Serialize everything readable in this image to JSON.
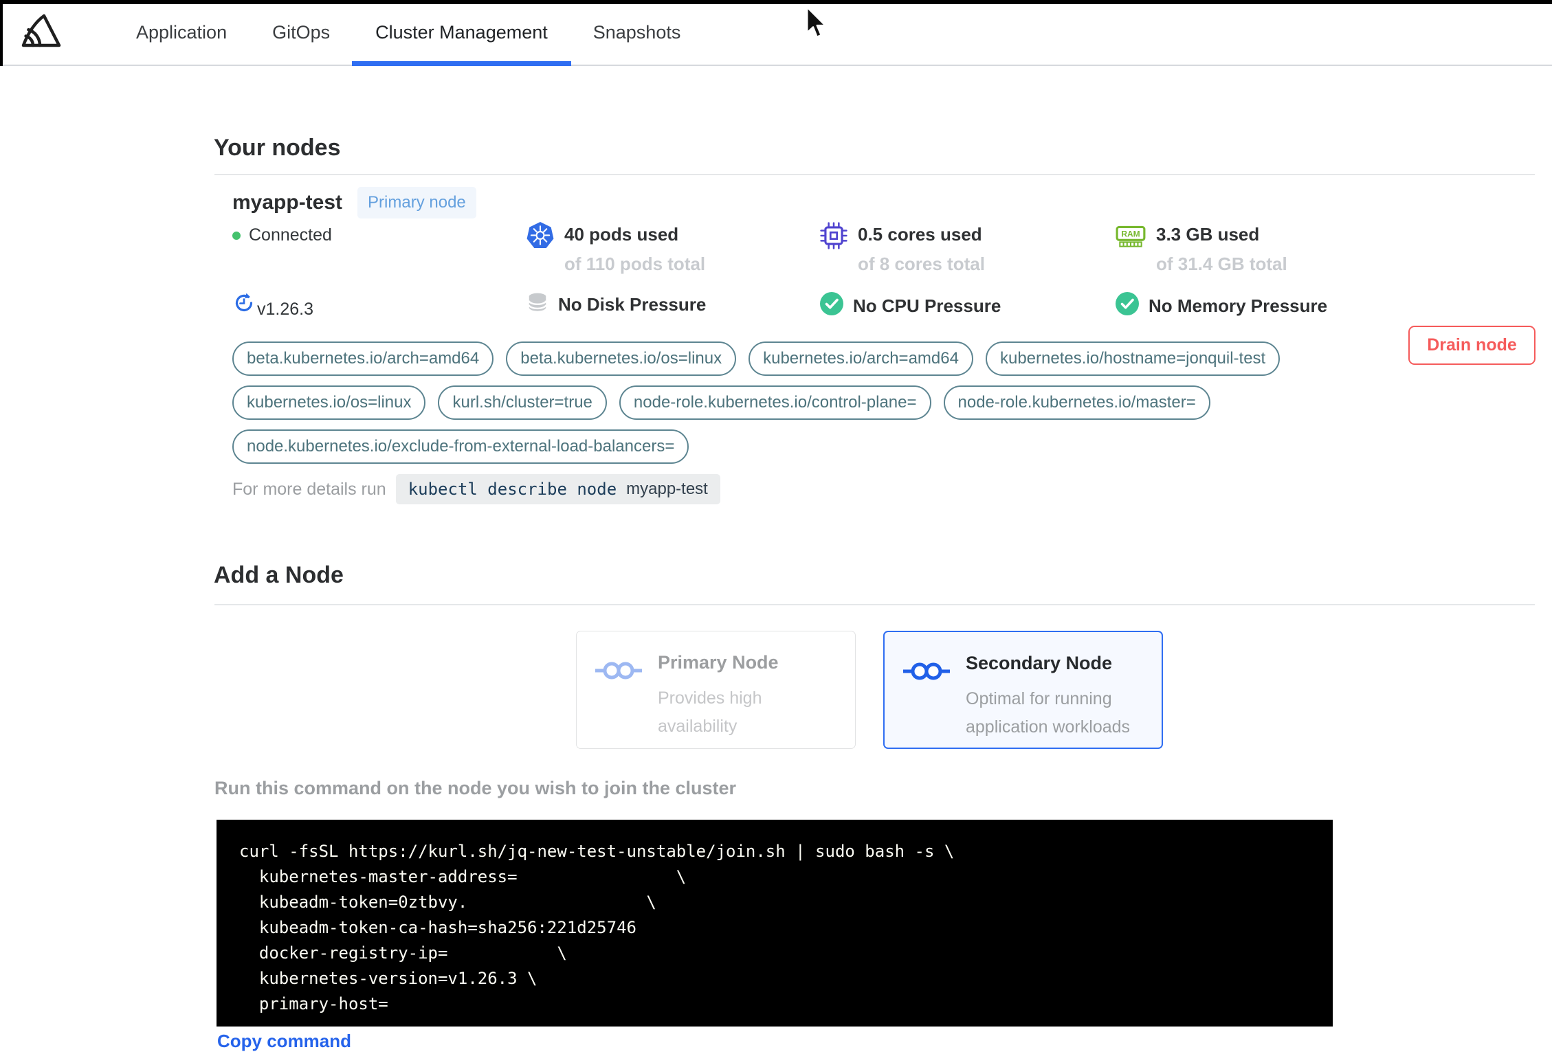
{
  "nav": {
    "tabs": [
      {
        "label": "Application"
      },
      {
        "label": "GitOps"
      },
      {
        "label": "Cluster Management"
      },
      {
        "label": "Snapshots"
      }
    ],
    "active_tab": "Cluster Management"
  },
  "your_nodes": {
    "heading": "Your nodes",
    "node": {
      "name": "myapp-test",
      "role_badge": "Primary node",
      "status": "Connected",
      "version": "v1.26.3",
      "pods": {
        "used": "40 pods used",
        "total": "of 110 pods total"
      },
      "cpu": {
        "used": "0.5 cores used",
        "total": "of 8 cores total"
      },
      "memory": {
        "used": "3.3 GB used",
        "total": "of 31.4 GB total"
      },
      "conditions": {
        "disk": "No Disk Pressure",
        "cpu": "No CPU Pressure",
        "memory": "No Memory Pressure"
      },
      "labels": [
        "beta.kubernetes.io/arch=amd64",
        "beta.kubernetes.io/os=linux",
        "kubernetes.io/arch=amd64",
        "kubernetes.io/hostname=jonquil-test",
        "kubernetes.io/os=linux",
        "kurl.sh/cluster=true",
        "node-role.kubernetes.io/control-plane=",
        "node-role.kubernetes.io/master=",
        "node.kubernetes.io/exclude-from-external-load-balancers="
      ],
      "details_prefix": "For more details run",
      "details_command": "kubectl describe node",
      "details_node": "myapp-test",
      "drain_button": "Drain node"
    }
  },
  "add_node": {
    "heading": "Add a Node",
    "options": [
      {
        "title": "Primary Node",
        "description": "Provides high availability",
        "selected": false
      },
      {
        "title": "Secondary Node",
        "description": "Optimal for running application workloads",
        "selected": true
      }
    ],
    "instruction": "Run this command on the node you wish to join the cluster",
    "join_command": "curl -fsSL https://kurl.sh/jq-new-test-unstable/join.sh | sudo bash -s \\\n  kubernetes-master-address=                \\\n  kubeadm-token=0ztbvy.                  \\\n  kubeadm-token-ca-hash=sha256:221d25746\n  docker-registry-ip=           \\\n  kubernetes-version=v1.26.3 \\\n  primary-host=",
    "copy_link": "Copy command"
  },
  "icons": {
    "brand": "replicated-logo-icon",
    "pods": "kubernetes-helm-wheel-icon",
    "cpu": "cpu-chip-icon",
    "memory": "ram-stick-icon",
    "version": "update-clock-icon",
    "disk": "database-icon",
    "condition_ok": "check-circle-icon",
    "node_option": "linked-nodes-icon",
    "pointer": "mouse-cursor"
  },
  "colors": {
    "accent_blue": "#2f6ef2",
    "kubernetes_blue": "#326ce5",
    "cpu_purple": "#4f43cf",
    "ram_green": "#77b82e",
    "success_green": "#3bc493",
    "connected_green": "#44c26d",
    "danger_red": "#f55b5b",
    "label_teal": "#4d737c",
    "link_blue": "#2563eb",
    "badge_blue": "#64a0de",
    "code_bg": "#000000"
  }
}
